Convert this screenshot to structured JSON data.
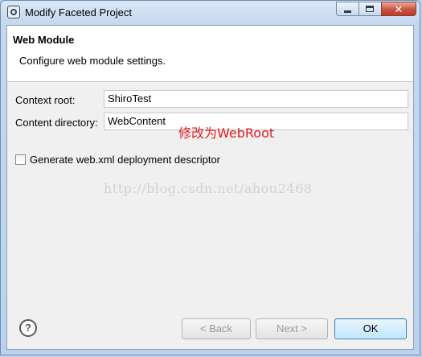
{
  "window": {
    "title": "Modify Faceted Project"
  },
  "header": {
    "title": "Web Module",
    "description": "Configure web module settings."
  },
  "form": {
    "context_root": {
      "label": "Context root:",
      "value": "ShiroTest"
    },
    "content_directory": {
      "label": "Content directory:",
      "value": "WebContent"
    },
    "annotation": "修改为WebRoot",
    "generate_xml": {
      "label": "Generate web.xml deployment descriptor",
      "checked": false
    }
  },
  "watermark": "http://blog.csdn.net/ahou2468",
  "footer": {
    "help_symbol": "?",
    "back_label": "< Back",
    "next_label": "Next >",
    "ok_label": "OK"
  },
  "colors": {
    "annotation": "#e21f1f",
    "ok_button_border": "#3c7fb1"
  }
}
